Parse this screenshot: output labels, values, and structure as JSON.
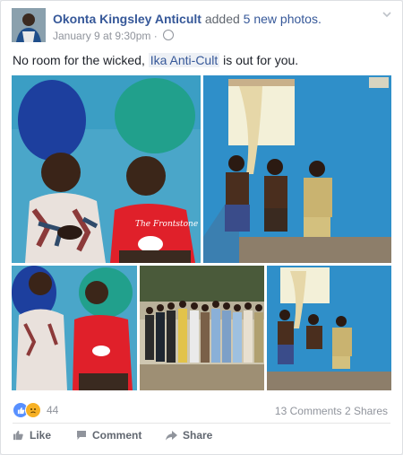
{
  "post": {
    "author": "Okonta Kingsley Anticult",
    "action_text": "added",
    "photos_text": "5 new photos.",
    "timestamp": "January 9 at 9:30pm",
    "separator": "·",
    "text_before": "No room for the wicked, ",
    "tag": "Ika Anti-Cult",
    "text_after": " is out for you."
  },
  "photos": {
    "shirt_text": "The Frontstone"
  },
  "stats": {
    "reaction_count": "44",
    "comments": "13 Comments",
    "shares": "2 Shares"
  },
  "actions": {
    "like": "Like",
    "comment": "Comment",
    "share": "Share"
  },
  "colors": {
    "link": "#365899",
    "like_blue": "#5890ff",
    "sad_yellow": "#f7b125",
    "wall_blue": "#2f8fc9",
    "shirt_red": "#e0202a"
  }
}
